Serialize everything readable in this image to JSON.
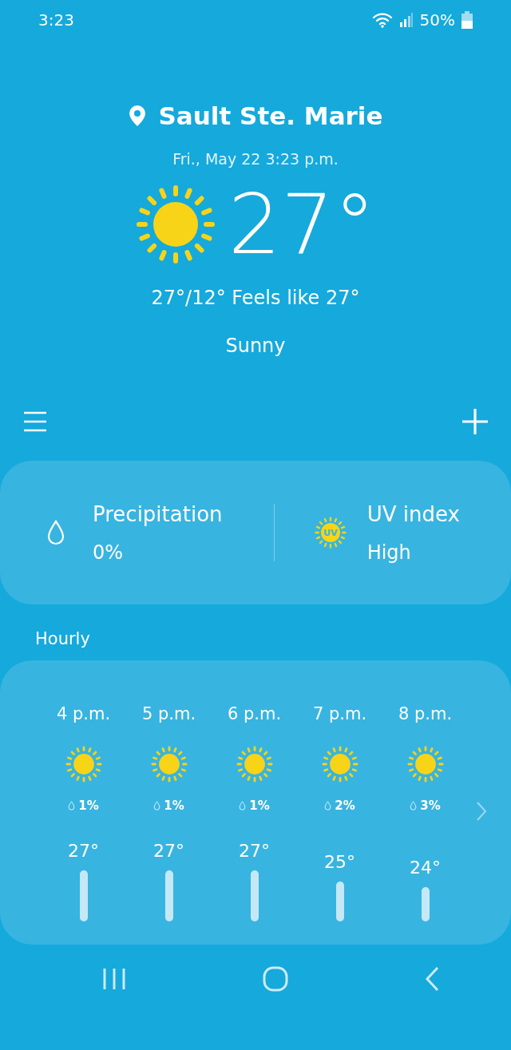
{
  "status_bar": {
    "time": "3:23",
    "battery": "50%"
  },
  "location": {
    "name": "Sault Ste. Marie",
    "date": "Fri., May 22 3:23 p.m."
  },
  "current": {
    "temperature": "27°",
    "high_low_feels": "27°/12° Feels like 27°",
    "condition": "Sunny"
  },
  "details": [
    {
      "kind": "precipitation",
      "label": "Precipitation",
      "value": "0%"
    },
    {
      "kind": "uv",
      "label": "UV index",
      "value": "High",
      "icon_text": "UV"
    }
  ],
  "hourly": {
    "title": "Hourly",
    "hours": [
      {
        "time": "4 p.m.",
        "precipitation": "1%",
        "temperature": "27°"
      },
      {
        "time": "5 p.m.",
        "precipitation": "1%",
        "temperature": "27°"
      },
      {
        "time": "6 p.m.",
        "precipitation": "1%",
        "temperature": "27°"
      },
      {
        "time": "7 p.m.",
        "precipitation": "2%",
        "temperature": "25°"
      },
      {
        "time": "8 p.m.",
        "precipitation": "3%",
        "temperature": "24°"
      }
    ]
  }
}
